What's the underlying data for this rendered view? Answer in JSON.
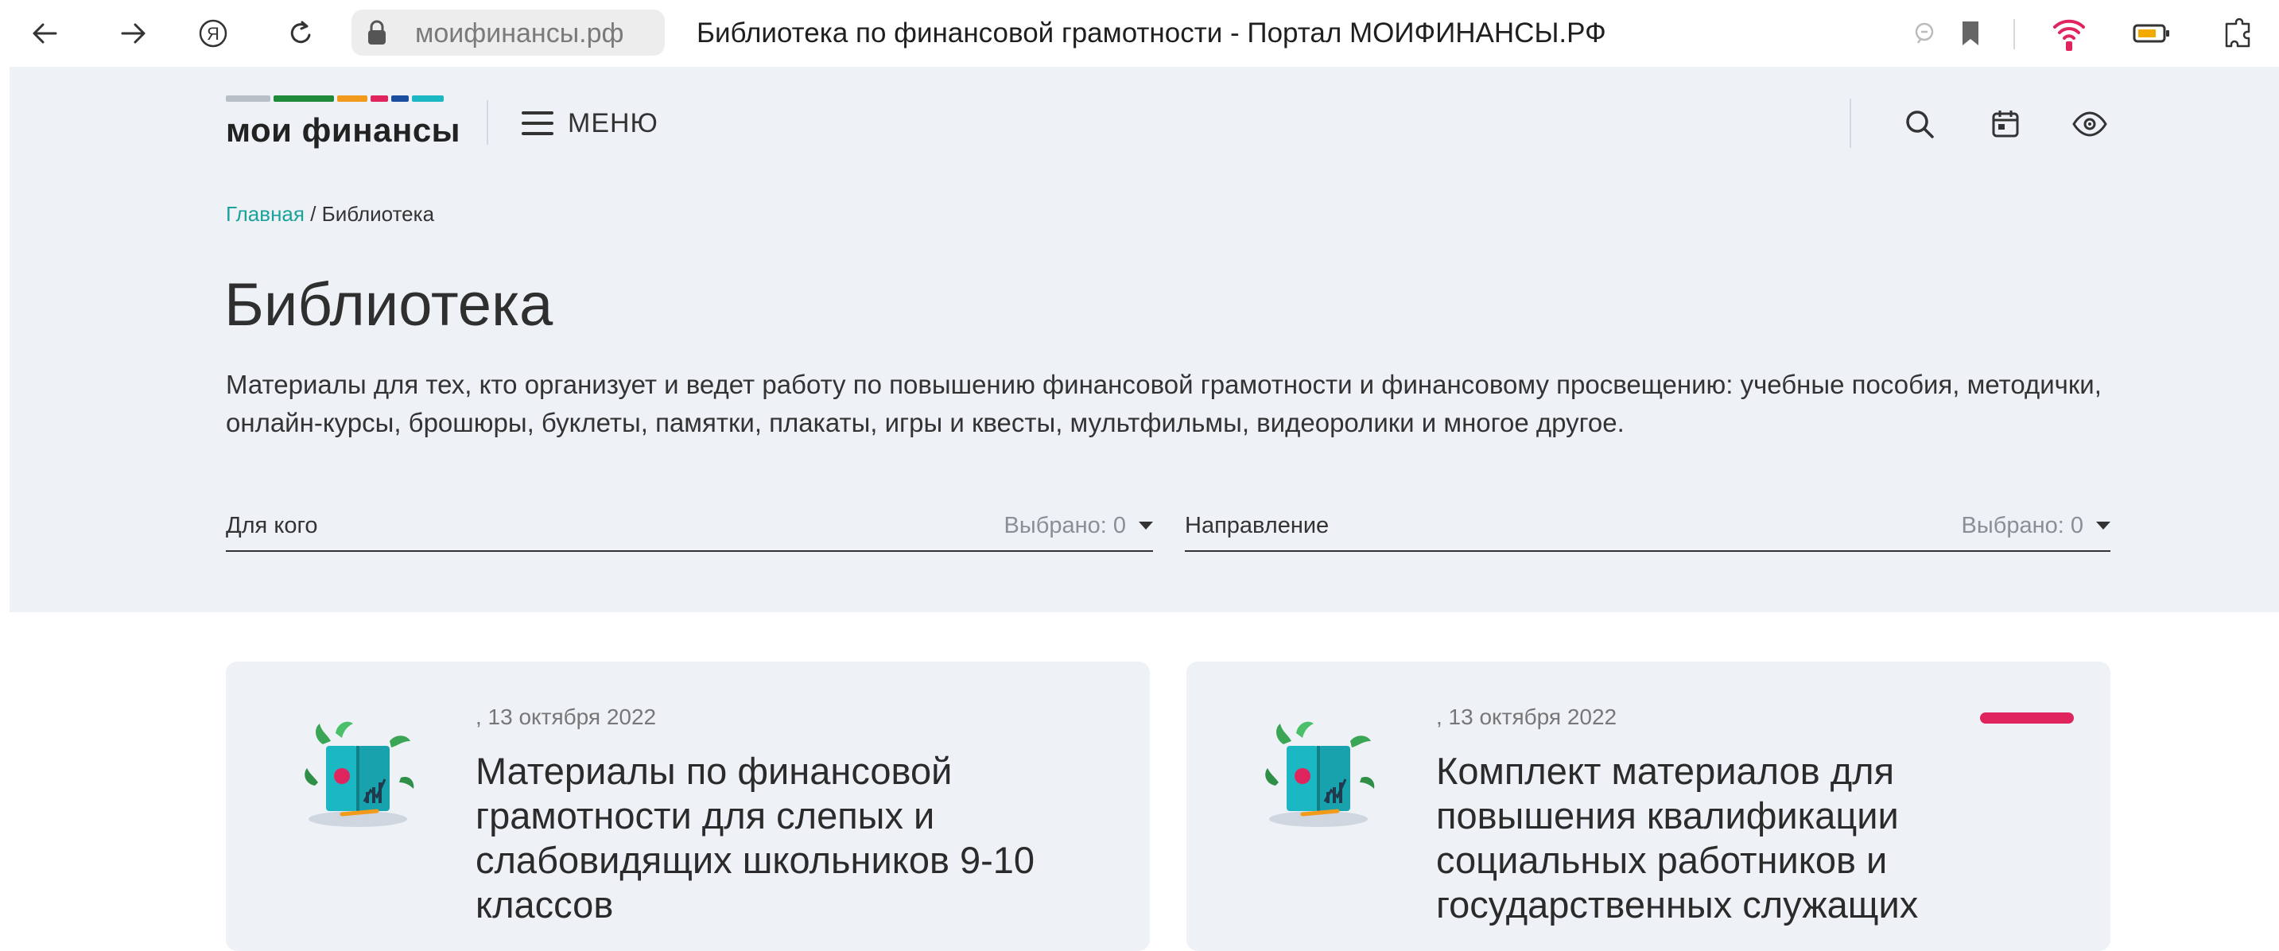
{
  "browser": {
    "url": "моифинансы.рф",
    "page_title": "Библиотека по финансовой грамотности - Портал МОИФИНАНСЫ.РФ",
    "icons": [
      "back-arrow-icon",
      "forward-arrow-icon",
      "yandex-icon",
      "reload-icon",
      "lock-icon",
      "reader-icon",
      "bookmark-icon",
      "wifi-icon",
      "battery-icon",
      "extensions-icon"
    ]
  },
  "site": {
    "logo_text": "мои финансы",
    "logo_colors": [
      "#b9bfc6",
      "#1f8a3a",
      "#f29a1c",
      "#e0245e",
      "#1a4fa0",
      "#1bb8c4"
    ],
    "menu_label": "МЕНЮ",
    "header_icons": [
      "search-icon",
      "calendar-icon",
      "accessibility-eye-icon"
    ]
  },
  "breadcrumb": {
    "home": "Главная",
    "separator": "/",
    "current": "Библиотека"
  },
  "page": {
    "title": "Библиотека",
    "description": "Материалы для тех, кто организует и ведет работу по повышению финансовой грамотности и финансовому просвещению: учебные пособия, методички, онлайн-курсы, брошюры, буклеты, памятки, плакаты, игры и квесты, мультфильмы, видеоролики и многое другое."
  },
  "filters": [
    {
      "label": "Для кого",
      "value": "Выбрано: 0"
    },
    {
      "label": "Направление",
      "value": "Выбрано: 0"
    }
  ],
  "cards": [
    {
      "date": ", 13 октября 2022",
      "title": "Материалы по финансовой грамотности для слепых и слабовидящих школьников 9-10 классов",
      "accent": false
    },
    {
      "date": ", 13 октября 2022",
      "title": "Комплект материалов для повышения квалификации социальных работников и государственных служащих",
      "accent": true,
      "accent_color": "#e0245e"
    }
  ]
}
